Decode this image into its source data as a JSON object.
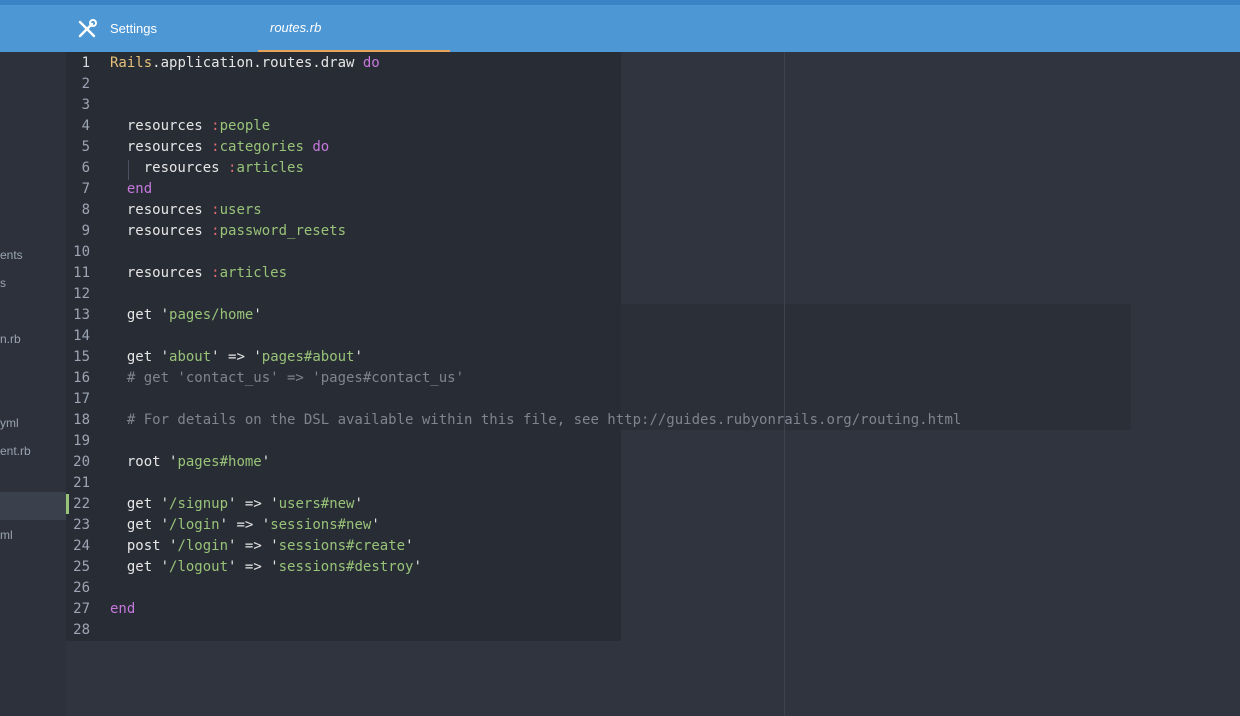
{
  "tabs": {
    "settings_label": "Settings",
    "routes_label": "routes.rb"
  },
  "tree": {
    "items": [
      "ents",
      "s",
      "n.rb",
      "yml",
      "ent.rb",
      "ml"
    ]
  },
  "editor": {
    "line_numbers": [
      "1",
      "2",
      "3",
      "4",
      "5",
      "6",
      "7",
      "8",
      "9",
      "10",
      "11",
      "12",
      "13",
      "14",
      "15",
      "16",
      "17",
      "18",
      "19",
      "20",
      "21",
      "22",
      "23",
      "24",
      "25",
      "26",
      "27",
      "28"
    ],
    "tokens": {
      "l1_const": "Rails",
      "l1_rest": ".application.routes.draw ",
      "kw_do": "do",
      "kw_end": "end",
      "resources": "resources ",
      "sym_colon": ":",
      "sym_people": "people",
      "sym_categories": "categories",
      "sym_articles": "articles",
      "sym_users": "users",
      "sym_password_resets": "password_resets",
      "get": "get ",
      "post": "post ",
      "root": "root ",
      "q": "'",
      "arrow": " => ",
      "str_pages_home": "pages/home",
      "str_about": "about",
      "str_pages_about": "pages#about",
      "comment_16": "# get 'contact_us' => 'pages#contact_us'",
      "comment_18": "# For details on the DSL available within this file, see http://guides.rubyonrails.org/routing.html",
      "str_pages_home_hash": "pages#home",
      "str_signup": "/signup",
      "str_users_new": "users#new",
      "str_login": "/login",
      "str_sessions_new": "sessions#new",
      "str_sessions_create": "sessions#create",
      "str_logout": "/logout",
      "str_sessions_destroy": "sessions#destroy"
    }
  }
}
